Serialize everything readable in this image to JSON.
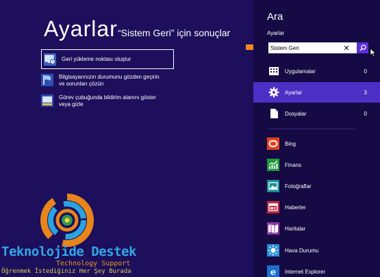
{
  "main": {
    "title": "Ayarlar",
    "subtitle": "“Sistem Geri” için sonuçlar",
    "results": [
      {
        "label": "Geri yükleme noktası oluştur",
        "icon": "system-restore-icon"
      },
      {
        "label_line1": "Bilgisayarınızın durumunu gözden geçirin",
        "label_line2": "ve sorunları çözün",
        "icon": "action-center-flag-icon"
      },
      {
        "label_line1": "Görev çubuğunda bildirim alanını göster",
        "label_line2": "veya gizle",
        "icon": "taskbar-icon"
      }
    ]
  },
  "watermark": {
    "brand": "Teknolojide Destek",
    "sub": "Technology Support",
    "tagline": "Öğrenmek İstediğiniz Her Şey Burada"
  },
  "panel": {
    "title": "Ara",
    "scope": "Ayarlar",
    "search_value": "Sistem Geri",
    "categories": [
      {
        "label": "Uygulamalar",
        "count": "0",
        "icon": "apps-grid-icon"
      },
      {
        "label": "Ayarlar",
        "count": "3",
        "icon": "gear-icon"
      },
      {
        "label": "Dosyalar",
        "count": "0",
        "icon": "file-icon"
      }
    ],
    "apps": [
      {
        "label": "Bing",
        "icon": "bing-icon",
        "color": "#e8401c"
      },
      {
        "label": "Finans",
        "icon": "finance-chart-icon",
        "color": "#1f9a3a"
      },
      {
        "label": "Fotoğraflar",
        "icon": "photos-icon",
        "color": "#178f96"
      },
      {
        "label": "Haberler",
        "icon": "news-icon",
        "color": "#c2263c"
      },
      {
        "label": "Haritalar",
        "icon": "maps-icon",
        "color": "#8e3aa3"
      },
      {
        "label": "Hava Durumu",
        "icon": "weather-sun-icon",
        "color": "#2c8fd6"
      },
      {
        "label": "Internet Explorer",
        "icon": "internet-explorer-icon",
        "color": "#1b6fd0"
      }
    ]
  },
  "colors": {
    "background": "#1d0f5c",
    "panel": "#160a44",
    "accent": "#4c2fc4",
    "search_button": "#5a2fd6",
    "arrow": "#f2891e"
  }
}
